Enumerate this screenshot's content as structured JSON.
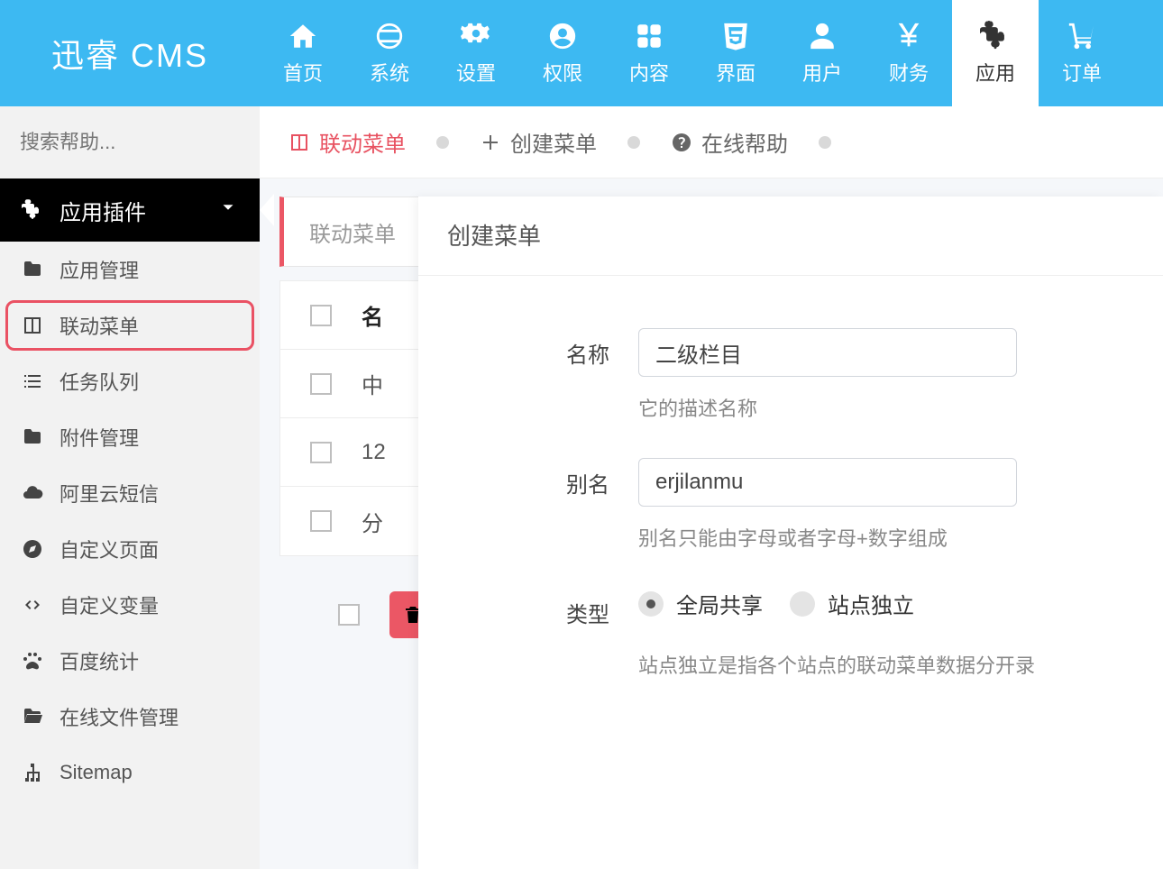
{
  "brand": "迅睿 CMS",
  "nav": [
    {
      "label": "首页",
      "icon": "home"
    },
    {
      "label": "系统",
      "icon": "globe"
    },
    {
      "label": "设置",
      "icon": "cogs"
    },
    {
      "label": "权限",
      "icon": "user-circle"
    },
    {
      "label": "内容",
      "icon": "grid"
    },
    {
      "label": "界面",
      "icon": "html5"
    },
    {
      "label": "用户",
      "icon": "user"
    },
    {
      "label": "财务",
      "icon": "yen"
    },
    {
      "label": "应用",
      "icon": "puzzle",
      "active": true
    },
    {
      "label": "订单",
      "icon": "cart"
    }
  ],
  "search": {
    "placeholder": "搜索帮助..."
  },
  "side_group": {
    "label": "应用插件"
  },
  "side_items": [
    {
      "label": "应用管理",
      "icon": "folder"
    },
    {
      "label": "联动菜单",
      "icon": "columns",
      "highlight": true
    },
    {
      "label": "任务队列",
      "icon": "tasks"
    },
    {
      "label": "附件管理",
      "icon": "folder"
    },
    {
      "label": "阿里云短信",
      "icon": "cloud"
    },
    {
      "label": "自定义页面",
      "icon": "compass"
    },
    {
      "label": "自定义变量",
      "icon": "code"
    },
    {
      "label": "百度统计",
      "icon": "paw"
    },
    {
      "label": "在线文件管理",
      "icon": "folder-open"
    },
    {
      "label": "Sitemap",
      "icon": "sitemap"
    }
  ],
  "tabs": [
    {
      "label": "联动菜单",
      "icon": "columns",
      "active": true
    },
    {
      "label": "创建菜单",
      "icon": "plus"
    },
    {
      "label": "在线帮助",
      "icon": "question"
    }
  ],
  "card_tab": "联动菜单",
  "table": {
    "header": "名",
    "rows": [
      "中",
      "12",
      "分"
    ]
  },
  "drawer": {
    "title": "创建菜单",
    "name_label": "名称",
    "name_value": "二级栏目",
    "name_hint": "它的描述名称",
    "alias_label": "别名",
    "alias_value": "erjilanmu",
    "alias_hint": "别名只能由字母或者字母+数字组成",
    "type_label": "类型",
    "type_opts": [
      "全局共享",
      "站点独立"
    ],
    "type_hint": "站点独立是指各个站点的联动菜单数据分开录"
  }
}
